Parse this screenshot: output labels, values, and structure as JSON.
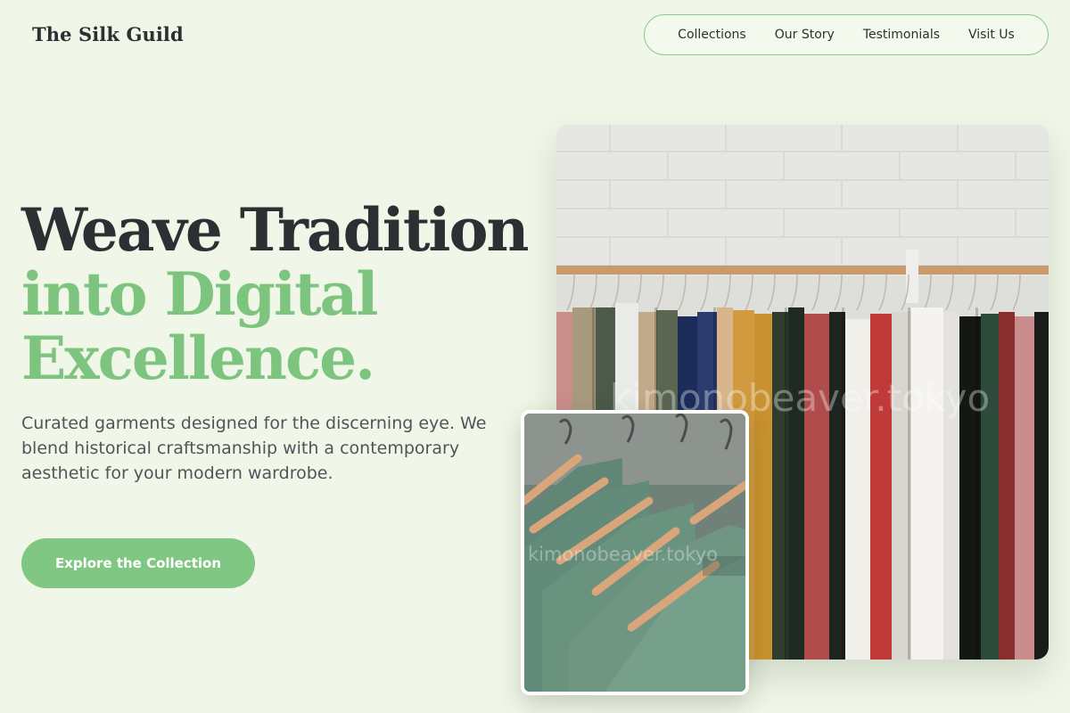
{
  "header": {
    "logo": "The Silk Guild",
    "nav": [
      {
        "label": "Collections"
      },
      {
        "label": "Our Story"
      },
      {
        "label": "Testimonials"
      },
      {
        "label": "Visit Us"
      }
    ]
  },
  "hero": {
    "headline_line1": "Weave Tradition",
    "headline_line2": "into Digital",
    "headline_line3": "Excellence.",
    "subcopy": "Curated garments designed for the discerning eye. We blend historical craftsmanship with a contemporary aesthetic for your modern wardrobe.",
    "cta_label": "Explore the Collection"
  },
  "images": {
    "main_watermark": "kimonobeaver.tokyo",
    "inset_watermark": "kimonobeaver.tokyo"
  },
  "colors": {
    "background": "#f1f7e8",
    "accent": "#7dc47f",
    "text_dark": "#2b3033"
  }
}
